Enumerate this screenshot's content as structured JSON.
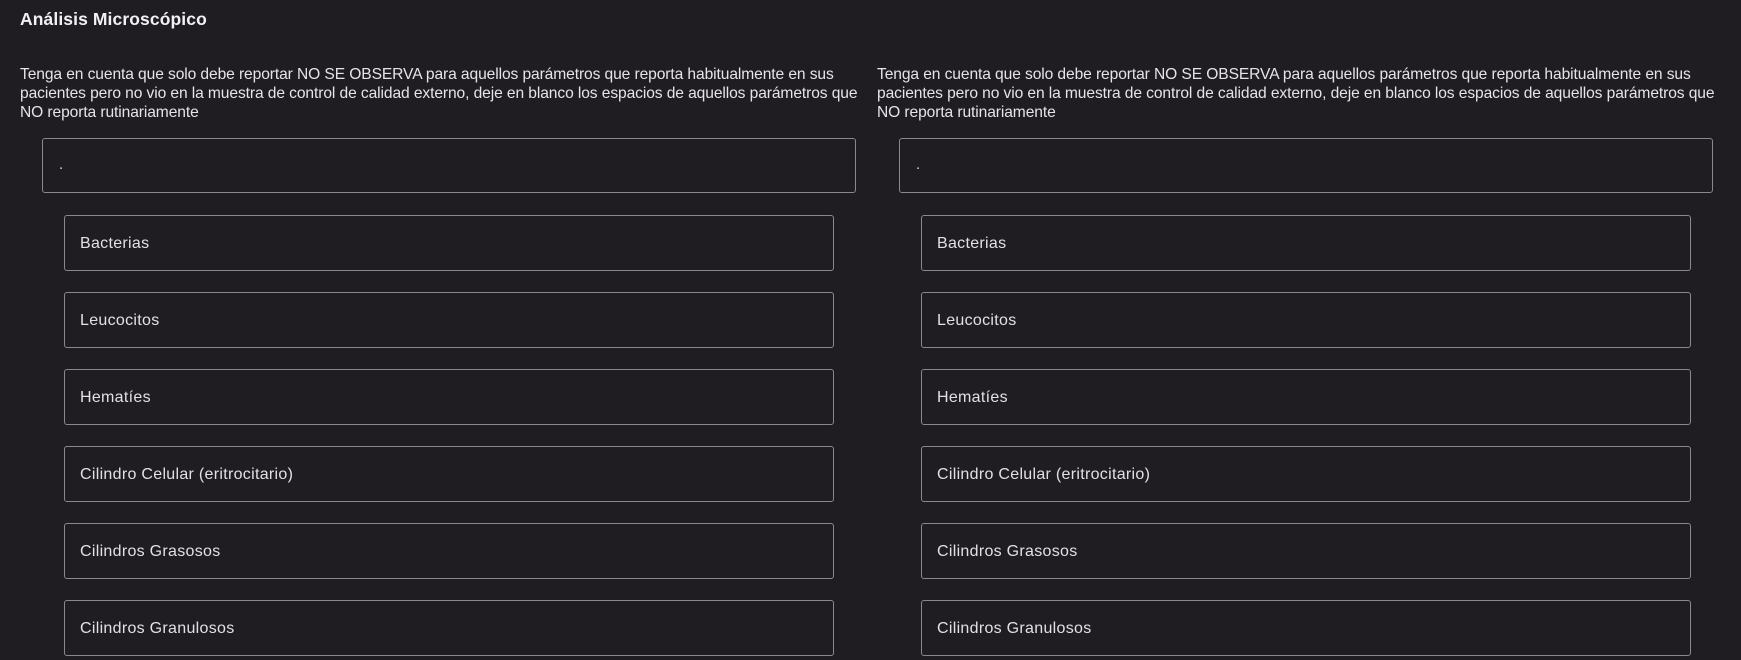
{
  "page": {
    "title": "Análisis Microscópico"
  },
  "columns": [
    {
      "note": "Tenga en cuenta que solo debe reportar NO SE OBSERVA para aquellos parámetros que reporta habitualmente en sus pacientes pero no vio en la muestra de control de calidad externo, deje en blanco los espacios de aquellos parámetros que NO reporta rutinariamente",
      "header_value": ".",
      "params": [
        "Bacterias",
        "Leucocitos",
        "Hematíes",
        "Cilindro Celular (eritrocitario)",
        "Cilindros Grasosos",
        "Cilindros Granulosos"
      ]
    },
    {
      "note": "Tenga en cuenta que solo debe reportar NO SE OBSERVA para aquellos parámetros que reporta habitualmente en sus pacientes pero no vio en la muestra de control de calidad externo, deje en blanco los espacios de aquellos parámetros que NO reporta rutinariamente",
      "header_value": ".",
      "params": [
        "Bacterias",
        "Leucocitos",
        "Hematíes",
        "Cilindro Celular (eritrocitario)",
        "Cilindros Grasosos",
        "Cilindros Granulosos"
      ]
    }
  ]
}
